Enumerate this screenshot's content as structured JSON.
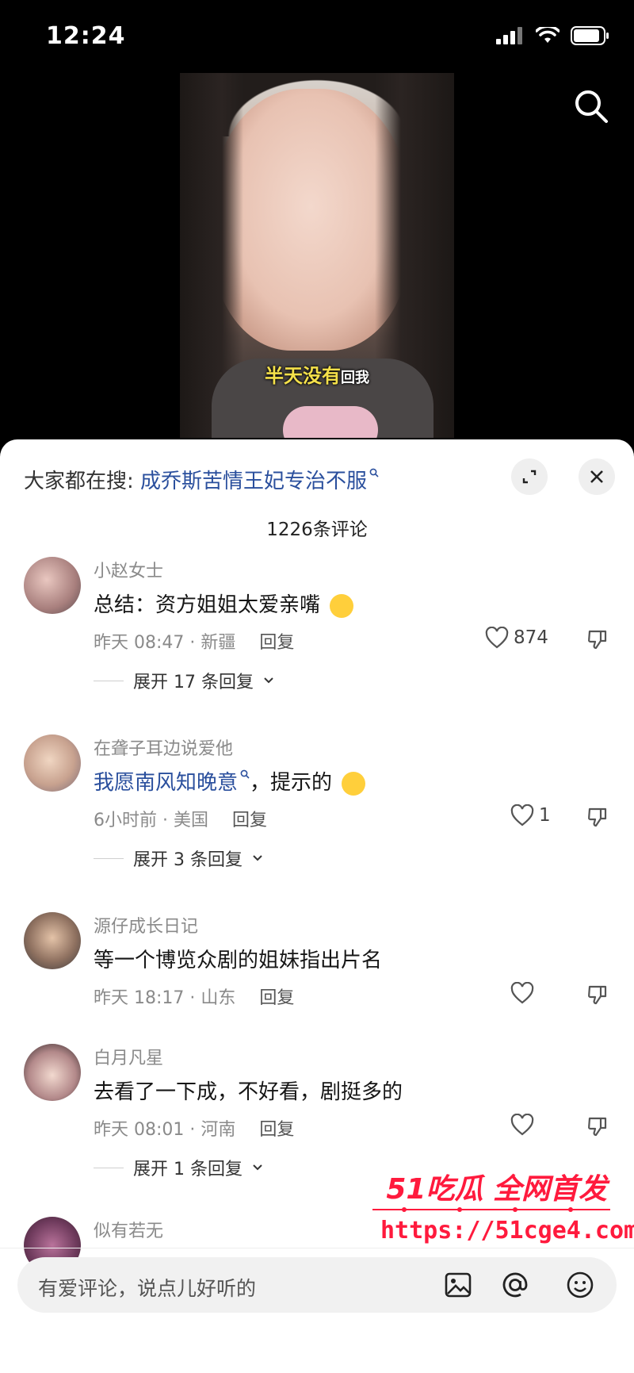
{
  "status_bar": {
    "time": "12:24"
  },
  "video": {
    "caption_highlight": "半天没有",
    "caption_rest": "回我"
  },
  "comments_panel": {
    "search_prefix": "大家都在搜:",
    "search_term": "成乔斯苦情王妃专治不服",
    "comment_count": "1226条评论",
    "comments": [
      {
        "username": "小赵女士",
        "text": "总结：资方姐姐太爱亲嘴",
        "time_location": "昨天 08:47 · 新疆",
        "reply_label": "回复",
        "likes": "874",
        "expand_label": "展开 17 条回复"
      },
      {
        "username": "在聋子耳边说爱他",
        "text_link": "我愿南风知晚意",
        "text_rest": "，提示的",
        "time_location": "6小时前 · 美国",
        "reply_label": "回复",
        "likes": "1",
        "expand_label": "展开 3 条回复"
      },
      {
        "username": "源仔成长日记",
        "text": "等一个博览众剧的姐妹指出片名",
        "time_location": "昨天 18:17 · 山东",
        "reply_label": "回复",
        "likes": ""
      },
      {
        "username": "白月凡星",
        "text": "去看了一下成，不好看，剧挺多的",
        "time_location": "昨天 08:01 · 河南",
        "reply_label": "回复",
        "likes": "",
        "expand_label": "展开 1 条回复"
      },
      {
        "username": "似有若无"
      }
    ]
  },
  "watermark": {
    "title": "51吃瓜 全网首发",
    "url": "https://51cge4.com"
  },
  "input_bar": {
    "placeholder": "有爱评论，说点儿好听的"
  },
  "icons": {
    "search": "search-icon",
    "expand": "expand-icon",
    "close": "close-icon",
    "like": "heart-icon",
    "dislike": "thumbs-down-icon",
    "image": "image-icon",
    "mention": "at-icon",
    "emoji": "emoji-icon"
  },
  "colors": {
    "link": "#2a4f9d",
    "caption_highlight": "#f4e04a",
    "watermark": "#ff1a3d"
  }
}
